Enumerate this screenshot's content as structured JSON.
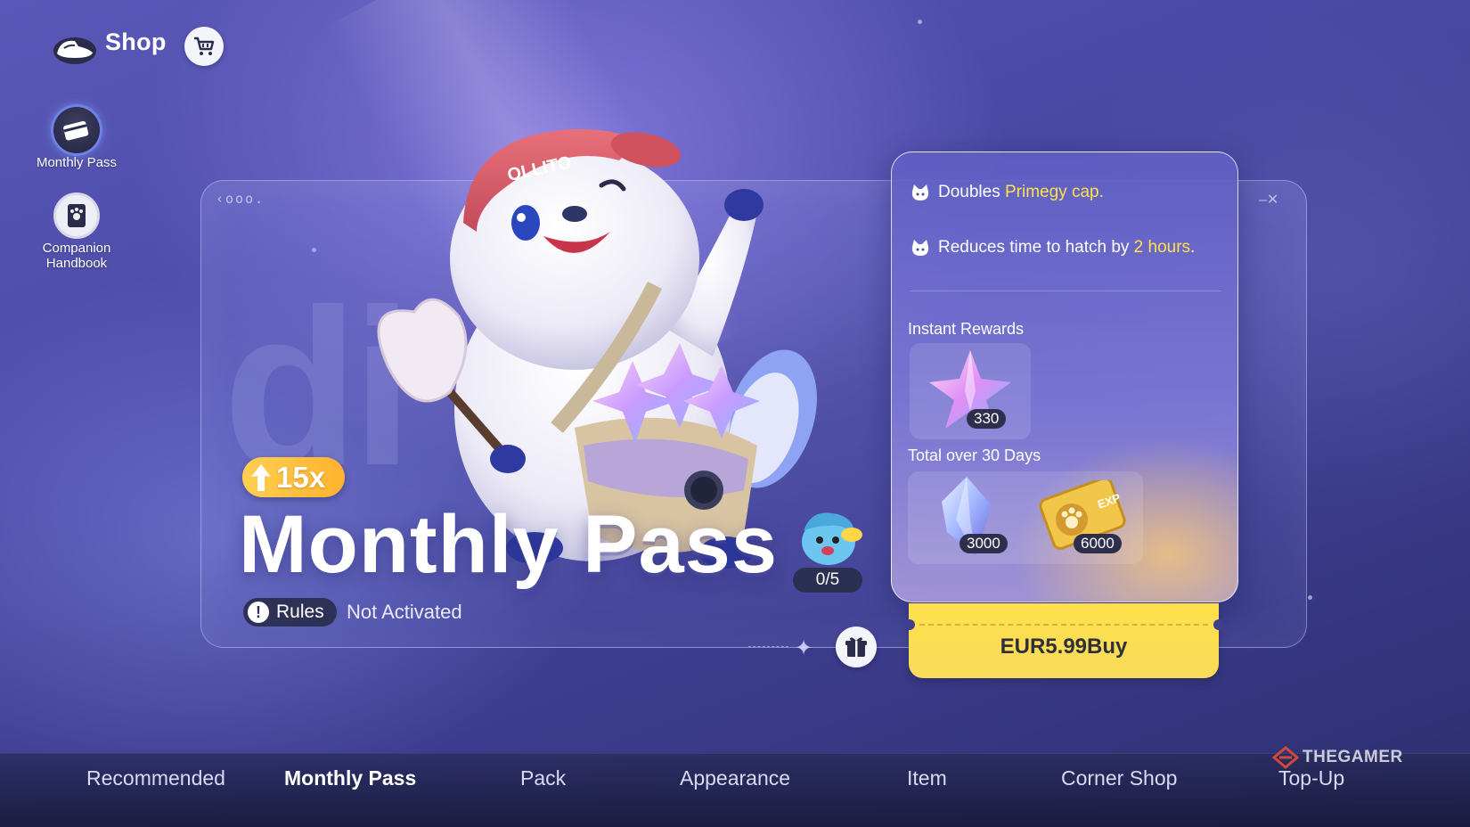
{
  "header": {
    "title": "Shop",
    "logo_icon": "shoe-icon",
    "cart_icon": "cart-icon"
  },
  "sidebar": {
    "items": [
      {
        "label": "Monthly Pass",
        "icon": "card-icon",
        "active": true
      },
      {
        "label": "Companion Handbook",
        "icon": "handbook-icon",
        "active": false
      }
    ]
  },
  "card": {
    "tag": "‹ooo.",
    "multiplier": "15x",
    "title": "Monthly Pass",
    "rules_label": "Rules",
    "status": "Not Activated",
    "companion_progress": "0/5"
  },
  "benefits": {
    "line1_prefix": "Doubles",
    "line1_highlight": "Primegy cap.",
    "line2_prefix": "Reduces time to hatch by",
    "line2_highlight": "2 hours",
    "line2_suffix": ".",
    "instant_title": "Instant Rewards",
    "instant_qty": "330",
    "total_title": "Total over 30 Days",
    "total_items": [
      {
        "icon": "crystal-icon",
        "qty": "3000"
      },
      {
        "icon": "exp-ticket-icon",
        "qty": "6000"
      }
    ]
  },
  "buy": {
    "label": "EUR5.99Buy"
  },
  "tabs": [
    {
      "label": "Recommended",
      "active": false
    },
    {
      "label": "Monthly Pass",
      "active": true
    },
    {
      "label": "Pack",
      "active": false
    },
    {
      "label": "Appearance",
      "active": false
    },
    {
      "label": "Item",
      "active": false
    },
    {
      "label": "Corner Shop",
      "active": false
    },
    {
      "label": "Top-Up",
      "active": false
    }
  ],
  "watermark": "THEGAMER",
  "colors": {
    "accent_yellow": "#ffe14a",
    "buy_button": "#ffe04c",
    "badge_orange": "#ffb22e",
    "background": "#4a4aa6"
  }
}
